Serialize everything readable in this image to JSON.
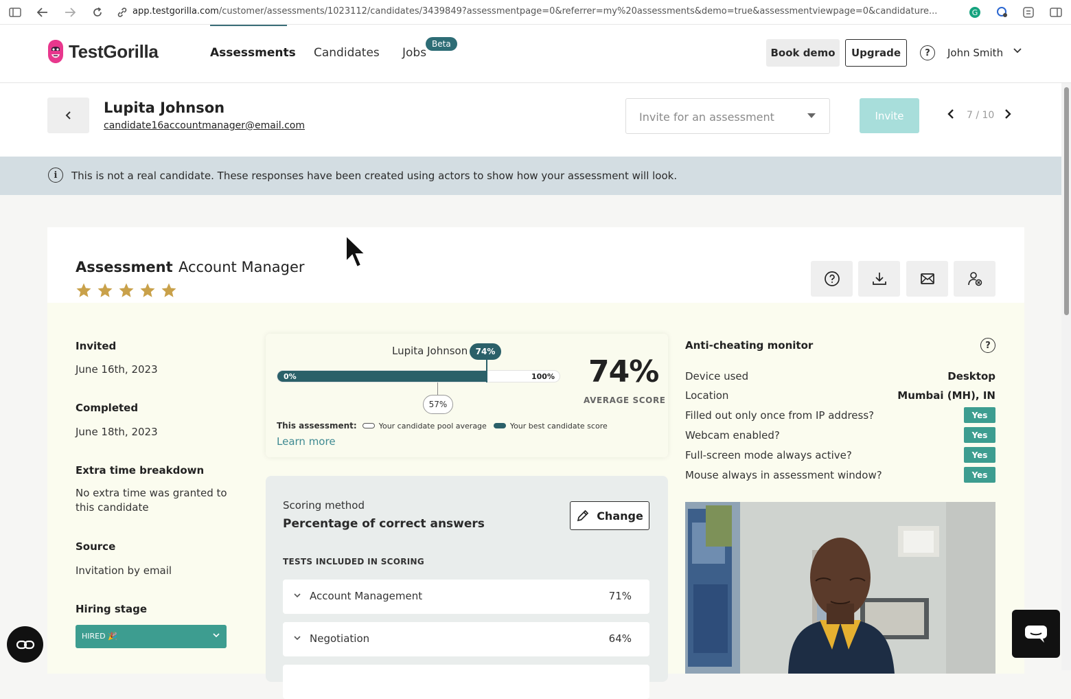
{
  "browser": {
    "url_host": "app.testgorilla.com",
    "url_path": "/customer/assessments/1023112/candidates/3439849?assessmentpage=0&referrer=my%20assessments&demo=true&assessmentviewpage=0&candidature..."
  },
  "header": {
    "logo_text": "TestGorilla",
    "nav": [
      {
        "label": "Assessments"
      },
      {
        "label": "Candidates"
      },
      {
        "label": "Jobs"
      }
    ],
    "beta_badge": "Beta",
    "book_demo": "Book demo",
    "upgrade": "Upgrade",
    "user_name": "John Smith"
  },
  "candidate": {
    "name": "Lupita Johnson",
    "email": "candidate16accountmanager@email.com",
    "invite_placeholder": "Invite for an assessment",
    "invite_button": "Invite",
    "pager": "7 / 10"
  },
  "banner": {
    "text": "This is not a real candidate. These responses have been created using actors to show how your assessment will look."
  },
  "assessment": {
    "label": "Assessment",
    "name": "Account Manager",
    "rating": 5,
    "rating_max": 5
  },
  "details": {
    "invited_label": "Invited",
    "invited_value": "June 16th, 2023",
    "completed_label": "Completed",
    "completed_value": "June 18th, 2023",
    "extra_time_label": "Extra time breakdown",
    "extra_time_value": "No extra time was granted to this candidate",
    "source_label": "Source",
    "source_value": "Invitation by email",
    "hiring_stage_label": "Hiring stage",
    "hiring_stage_value": "HIRED 🎉"
  },
  "score": {
    "candidate_label": "Lupita Johnson",
    "candidate_badge": "74%",
    "candidate_score": 74,
    "pool_average": 57,
    "pool_average_label": "57%",
    "bar_min": "0%",
    "bar_max": "100%",
    "big_value": "74%",
    "big_label": "AVERAGE SCORE",
    "legend_title": "This assessment:",
    "legend_pool": "Your candidate pool average",
    "legend_best": "Your best candidate score",
    "learn_more": "Learn more"
  },
  "scoring": {
    "method_label": "Scoring method",
    "method_value": "Percentage of correct answers",
    "change_button": "Change",
    "tests_heading": "TESTS INCLUDED IN SCORING",
    "tests": [
      {
        "name": "Account Management",
        "pct": "71%"
      },
      {
        "name": "Negotiation",
        "pct": "64%"
      }
    ]
  },
  "anticheat": {
    "title": "Anti-cheating monitor",
    "device_label": "Device used",
    "device_value": "Desktop",
    "location_label": "Location",
    "location_value": "Mumbai (MH), IN",
    "checks": [
      {
        "label": "Filled out only once from IP address?",
        "value": "Yes"
      },
      {
        "label": "Webcam enabled?",
        "value": "Yes"
      },
      {
        "label": "Full-screen mode always active?",
        "value": "Yes"
      },
      {
        "label": "Mouse always in assessment window?",
        "value": "Yes"
      }
    ]
  },
  "colors": {
    "teal_dark": "#2b6069",
    "teal": "#3d9d90",
    "invite_disabled": "#a8dedb",
    "banner_bg": "#d3dde2",
    "star": "#c9a14a"
  }
}
